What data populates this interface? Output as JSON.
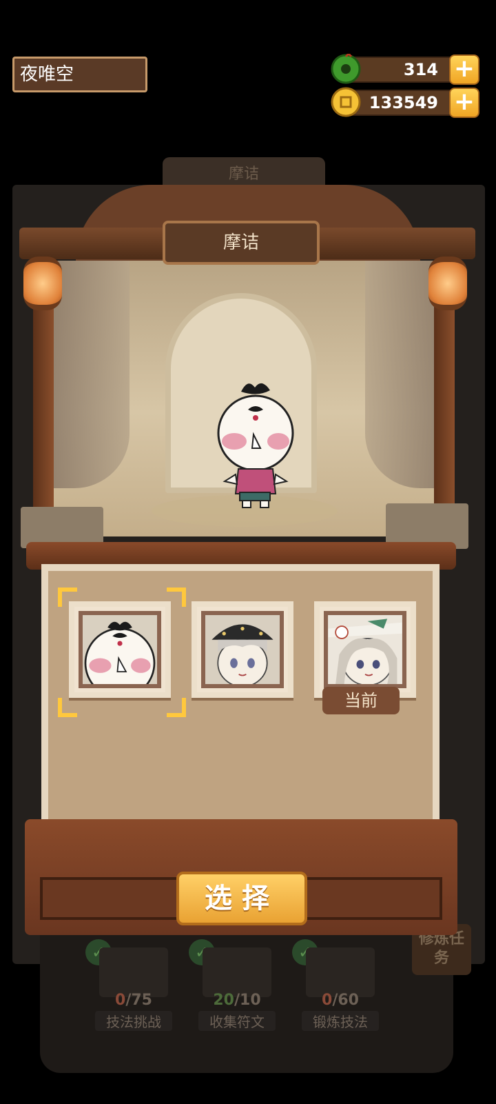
{
  "header": {
    "player_name": "夜唯空",
    "faded_hint": "",
    "jade_amount": "314",
    "coin_amount": "133549",
    "add_label": "+"
  },
  "stage": {
    "faded_tab_label": "摩诘",
    "character_name": "摩诘"
  },
  "selection": {
    "cards": [
      {
        "name": "avatar-mojie",
        "selected": true,
        "current": false
      },
      {
        "name": "avatar-black-hat",
        "selected": false,
        "current": false
      },
      {
        "name": "avatar-silver-hair",
        "selected": false,
        "current": true
      }
    ],
    "current_label": "当前",
    "select_button": "选择"
  },
  "background_tasks": {
    "items": [
      {
        "count_done": "0",
        "count_total": "/75",
        "label": "技法挑战"
      },
      {
        "count_done": "20",
        "count_total": "/10",
        "label": "收集符文"
      },
      {
        "count_done": "0",
        "count_total": "/60",
        "label": "锻炼技法"
      }
    ],
    "side_mission": "修炼任务"
  },
  "colors": {
    "accent_gold": "#ffc83d",
    "button_orange": "#f0a524",
    "wood_dark": "#5a3a25"
  }
}
